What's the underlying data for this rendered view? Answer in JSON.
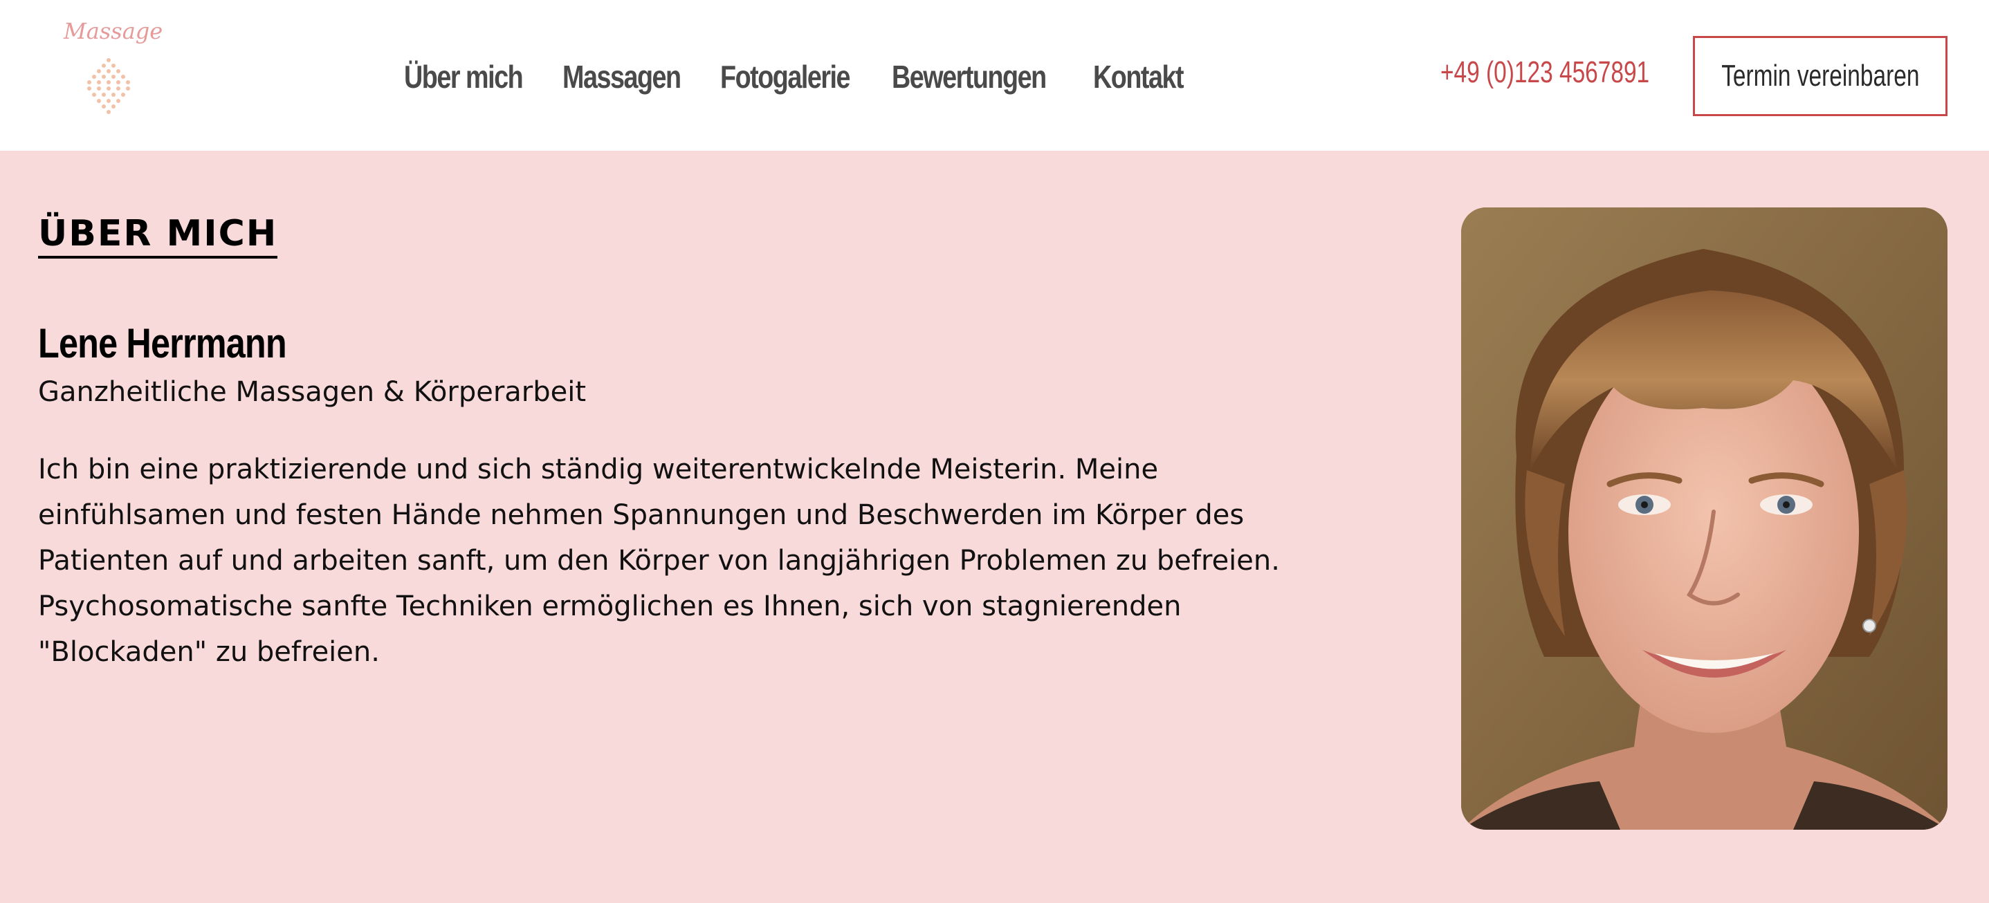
{
  "header": {
    "logo_text": "Massage",
    "nav": [
      {
        "label": "Über mich"
      },
      {
        "label": "Massagen"
      },
      {
        "label": "Fotogalerie"
      },
      {
        "label": "Bewertungen"
      },
      {
        "label": "Kontakt"
      }
    ],
    "phone": "+49 (0)123 4567891",
    "cta_label": "Termin vereinbaren"
  },
  "about": {
    "heading": "ÜBER MICH",
    "name": "Lene Herrmann",
    "subtitle": "Ganzheitliche Massagen & Körperarbeit",
    "bio_lines": [
      "Ich bin eine praktizierende und sich ständig weiterentwickelnde Meisterin. Meine",
      "einfühlsamen und festen Hände nehmen Spannungen und Beschwerden im Körper des",
      "Patienten auf und arbeiten sanft, um den Körper von langjährigen Problemen zu befreien.",
      "Psychosomatische sanfte Techniken ermöglichen es Ihnen, sich von stagnierenden",
      "\"Blockaden\" zu befreien."
    ]
  },
  "colors": {
    "page_background": "#f9dadb",
    "header_background": "#ffffff",
    "accent": "#c8484a",
    "nav_text": "#4a4a4a",
    "logo": "#e69a9a"
  }
}
